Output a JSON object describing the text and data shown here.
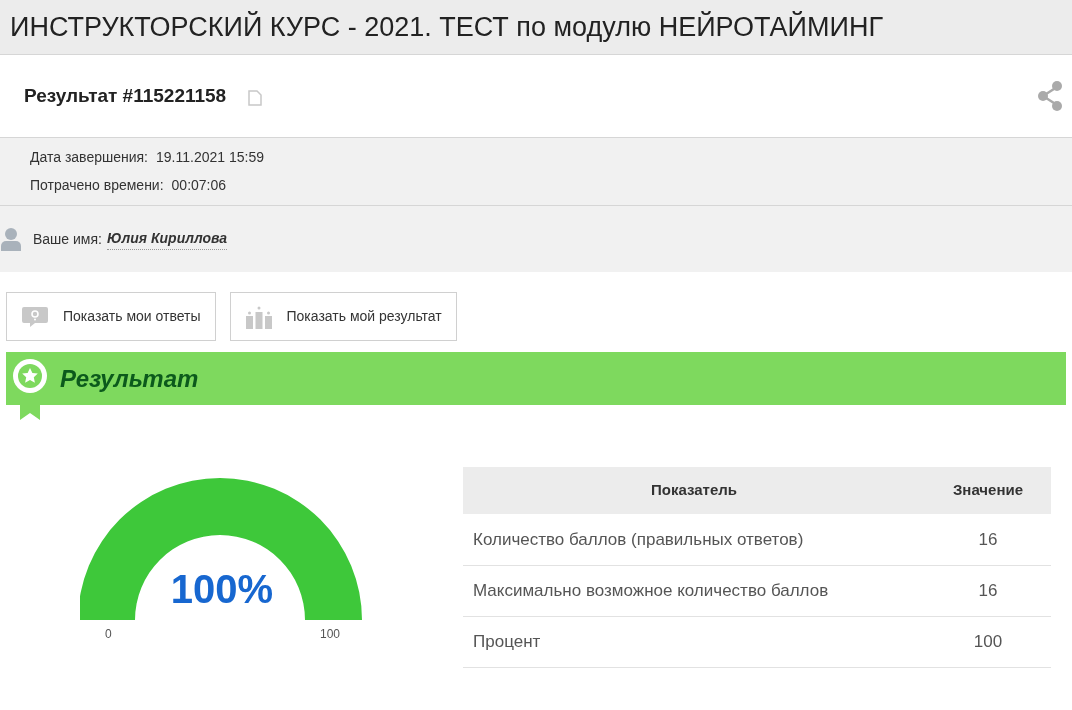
{
  "page_title": "ИНСТРУКТОРСКИЙ КУРС - 2021. ТЕСТ по модулю НЕЙРОТАЙМИНГ",
  "result": {
    "title": "Результат #115221158"
  },
  "details": [
    {
      "label": "Дата завершения:",
      "value": "19.11.2021 15:59"
    },
    {
      "label": "Потрачено времени:",
      "value": "00:07:06"
    }
  ],
  "user": {
    "label": "Ваше имя:",
    "name": "Юлия Кириллова"
  },
  "buttons": [
    {
      "kind": "answers",
      "label": "Показать мои ответы"
    },
    {
      "kind": "result",
      "label": "Показать мой результат"
    }
  ],
  "section": {
    "title": "Результат"
  },
  "gauge": {
    "value_text": "100%",
    "min_label": "0",
    "max_label": "100"
  },
  "table": {
    "columns": [
      "Показатель",
      "Значение"
    ],
    "rows": [
      [
        "Количество баллов (правильных ответов)",
        "16"
      ],
      [
        "Максимально возможное количество баллов",
        "16"
      ],
      [
        "Процент",
        "100"
      ]
    ]
  }
}
